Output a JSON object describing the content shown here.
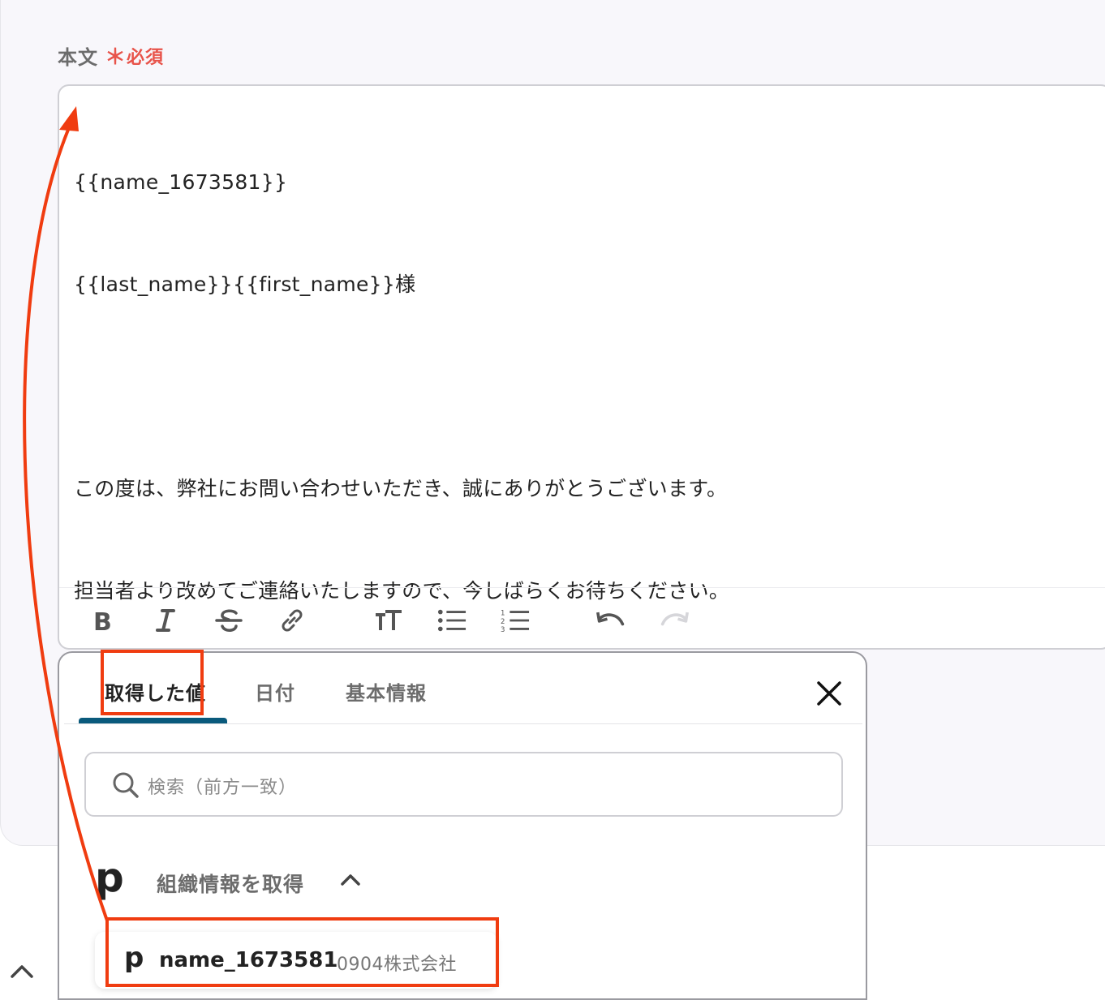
{
  "field": {
    "label": "本文",
    "required_star": "＊",
    "required_text": "必須"
  },
  "editor": {
    "lines": [
      "{{name_1673581}}",
      "{{last_name}}{{first_name}}様",
      "",
      "この度は、弊社にお問い合わせいただき、誠にありがとうございます。",
      "担当者より改めてご連絡いたしますので、今しばらくお待ちください。"
    ],
    "toolbar": [
      "bold-icon",
      "italic-icon",
      "strikethrough-icon",
      "link-icon",
      "text-size-icon",
      "bullet-list-icon",
      "numbered-list-icon",
      "undo-icon",
      "redo-icon"
    ]
  },
  "popup": {
    "tabs": [
      {
        "label": "取得した値",
        "active": true
      },
      {
        "label": "日付",
        "active": false
      },
      {
        "label": "基本情報",
        "active": false
      }
    ],
    "search_placeholder": "検索（前方一致）",
    "group": {
      "logo": "p",
      "title": "組織情報を取得"
    },
    "item": {
      "logo": "p",
      "name": "name_1673581",
      "value": "0904株式会社"
    }
  },
  "colors": {
    "accent_underline": "#0a5a7c",
    "required": "#e8534a",
    "annotation": "#f03c10"
  }
}
